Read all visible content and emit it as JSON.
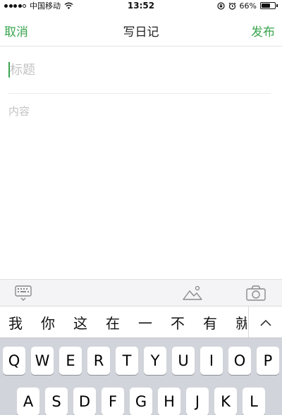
{
  "status_bar": {
    "carrier": "中国移动",
    "time": "13:52",
    "battery_percent": "66%",
    "battery_level": 0.66,
    "signal_bars_filled": 4,
    "icons": [
      "signal-dots-icon",
      "wifi-icon",
      "rotation-lock-icon",
      "alarm-icon",
      "battery-icon"
    ]
  },
  "nav": {
    "cancel": "取消",
    "title": "写日记",
    "publish": "发布"
  },
  "editor": {
    "title_placeholder": "标题",
    "content_placeholder": "内容"
  },
  "toolbar": {
    "icons": [
      "keyboard-dismiss-icon",
      "image-icon",
      "camera-icon"
    ]
  },
  "candidates": [
    "我",
    "你",
    "这",
    "在",
    "一",
    "不",
    "有",
    "就"
  ],
  "keyboard": {
    "row1": [
      "Q",
      "W",
      "E",
      "R",
      "T",
      "Y",
      "U",
      "I",
      "O",
      "P"
    ],
    "row2": [
      "A",
      "S",
      "D",
      "F",
      "G",
      "H",
      "J",
      "K",
      "L"
    ]
  },
  "colors": {
    "accent": "#3aa54e",
    "placeholder": "#c3c3c3",
    "keyboard_bg": "#d1d4da"
  }
}
